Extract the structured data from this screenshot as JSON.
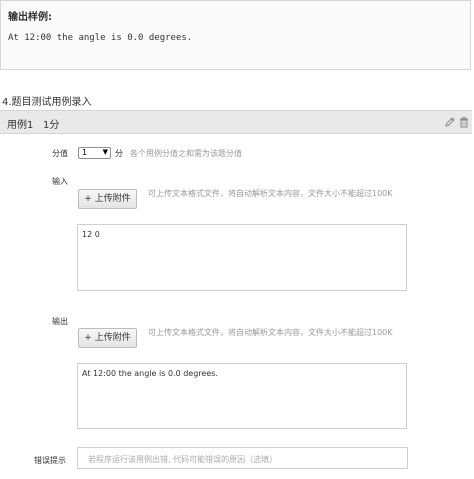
{
  "output_sample": {
    "title": "输出样例:",
    "code": "At 12:00 the angle is 0.0 degrees."
  },
  "section_title": "4.题目测试用例录入",
  "case": {
    "label": "用例1",
    "score": "1分",
    "edit_icon": "pencil-icon",
    "delete_icon": "trash-icon"
  },
  "score_row": {
    "label": "分值",
    "selected": "1",
    "unit": "分",
    "hint": "各个用例分值之和需为该题分值"
  },
  "input_section": {
    "label": "输入",
    "upload_label": "+ 上传附件",
    "hint": "可上传文本格式文件，将自动解析文本内容，文件大小不能超过100K",
    "value": "12 0"
  },
  "output_section": {
    "label": "输出",
    "upload_label": "+ 上传附件",
    "hint": "可上传文本格式文件，将自动解析文本内容，文件大小不能超过100K",
    "value": "At 12:00 the angle is 0.0 degrees."
  },
  "error_hint": {
    "label": "错误提示",
    "placeholder": "若程序运行该用例出错, 代码可能错误的原因（选填）"
  }
}
